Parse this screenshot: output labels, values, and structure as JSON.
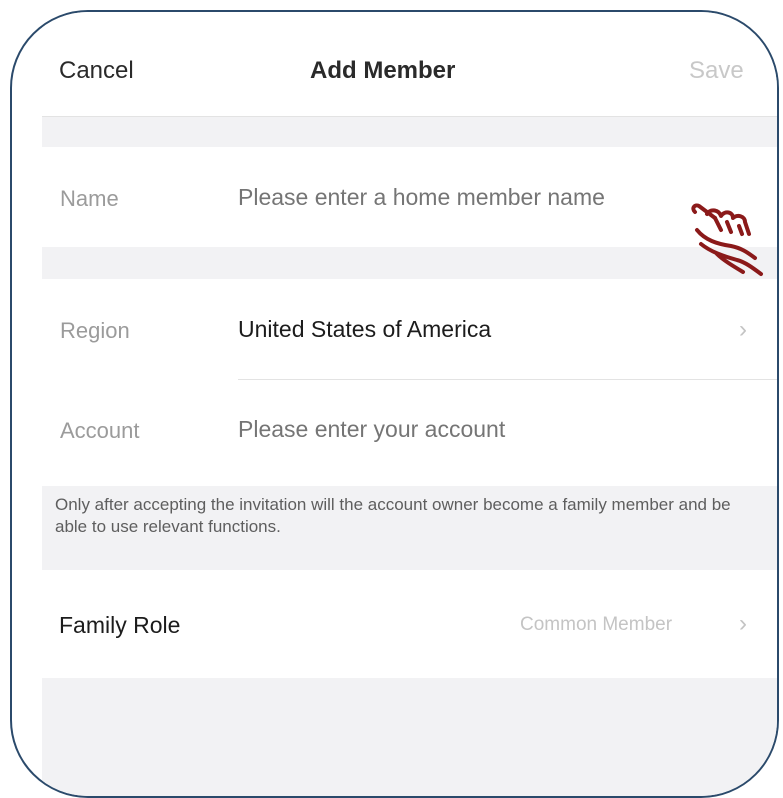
{
  "nav": {
    "cancel": "Cancel",
    "title": "Add Member",
    "save": "Save"
  },
  "form": {
    "name_label": "Name",
    "name_placeholder": "Please enter a home member name",
    "region_label": "Region",
    "region_value": "United States of America",
    "account_label": "Account",
    "account_placeholder": "Please enter your account"
  },
  "note": "Only after accepting the invitation will the account owner become a family member and be able to use relevant functions.",
  "role": {
    "label": "Family Role",
    "value": "Common Member"
  },
  "icons": {
    "chevron": "chevron-right-icon",
    "pointer": "pointing-hand-icon"
  },
  "colors": {
    "frame_border": "#2b4a6b",
    "pointer_hand": "#8b1a1a",
    "section_bg": "#f2f2f4"
  }
}
